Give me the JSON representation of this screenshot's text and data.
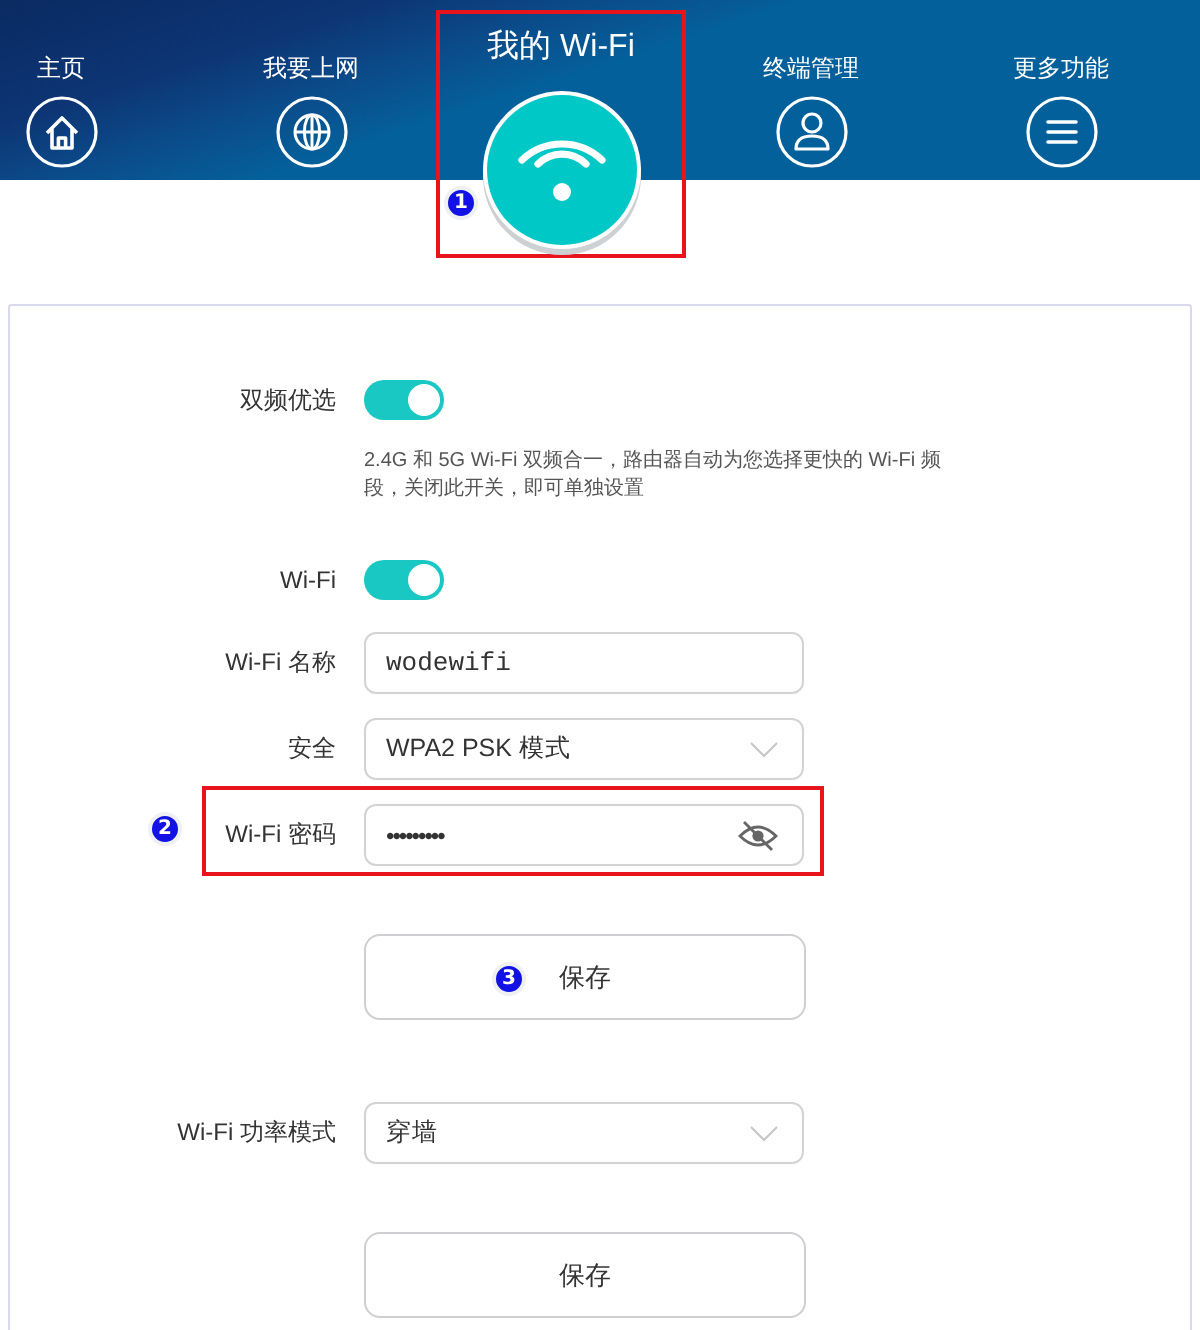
{
  "nav": {
    "items": [
      {
        "label": "主页",
        "selected": false,
        "highlighted": false
      },
      {
        "label": "我要上网",
        "selected": false,
        "highlighted": false
      },
      {
        "label": "我的 Wi-Fi",
        "selected": true,
        "highlighted": true,
        "step_badge": "1"
      },
      {
        "label": "终端管理",
        "selected": false,
        "highlighted": false
      },
      {
        "label": "更多功能",
        "selected": false,
        "highlighted": false
      }
    ]
  },
  "settings": [
    {
      "kind": "toggle",
      "label": "双频优选",
      "on": true,
      "highlighted": false,
      "note": "2.4G 和 5G Wi-Fi 双频合一，路由器自动为您选择更快的 Wi-Fi 频段，关闭此开关，即可单独设置"
    },
    {
      "kind": "toggle",
      "label": "Wi-Fi",
      "on": true,
      "highlighted": false
    },
    {
      "kind": "text",
      "label": "Wi-Fi 名称",
      "value": "wodewifi",
      "highlighted": false
    },
    {
      "kind": "select",
      "label": "安全",
      "value": "WPA2 PSK 模式",
      "highlighted": false
    },
    {
      "kind": "password",
      "label": "Wi-Fi 密码",
      "value": "•••••••••",
      "highlighted": true,
      "step_badge": "2"
    },
    {
      "kind": "button",
      "label": "保存",
      "highlighted": false,
      "step_badge": "3"
    },
    {
      "kind": "select",
      "label": "Wi-Fi 功率模式",
      "value": "穿墙",
      "highlighted": false
    },
    {
      "kind": "button",
      "label": "保存",
      "highlighted": false
    }
  ]
}
